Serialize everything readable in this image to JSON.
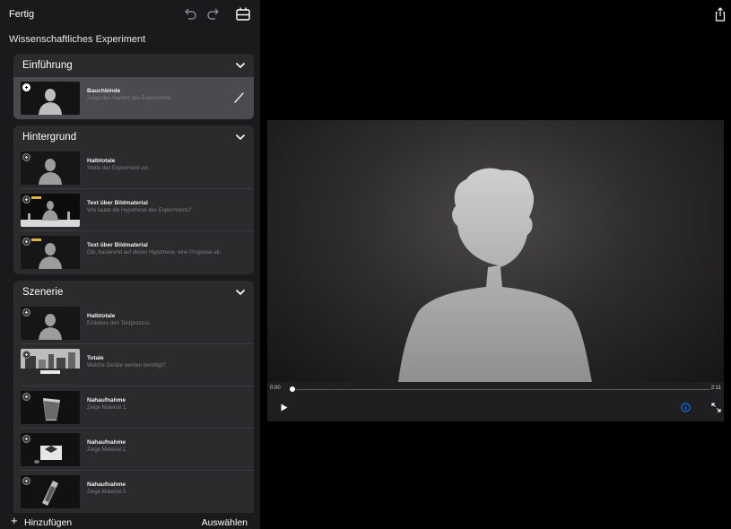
{
  "toolbar": {
    "done_label": "Fertig",
    "icons": [
      "undo-icon",
      "redo-icon",
      "storyboard-icon"
    ]
  },
  "project": {
    "title": "Wissenschaftliches Experiment"
  },
  "sections": [
    {
      "title": "Einführung",
      "shots": [
        {
          "title": "Bauchbinde",
          "description": "Zeige den Namen des Experiments.",
          "selected": true,
          "thumbnail": "person-silhouette"
        }
      ]
    },
    {
      "title": "Hintergrund",
      "shots": [
        {
          "title": "Halbtotale",
          "description": "Stelle das Experiment vor.",
          "thumbnail": "person-silhouette"
        },
        {
          "title": "Text über Bildmaterial",
          "description": "Wie lautet die Hypothese des Experiments?",
          "thumbnail": "lab-wide-with-title"
        },
        {
          "title": "Text über Bildmaterial",
          "description": "Gib, basierend auf deiner Hypothese, eine Prognose ab.",
          "thumbnail": "person-with-title"
        }
      ]
    },
    {
      "title": "Szenerie",
      "shots": [
        {
          "title": "Halbtotale",
          "description": "Erläutere den Testprozess.",
          "thumbnail": "person-silhouette"
        },
        {
          "title": "Totale",
          "description": "Welche Geräte werden benötigt?",
          "thumbnail": "lab-equipment"
        },
        {
          "title": "Nahaufnahme",
          "description": "Zeige Material 1.",
          "thumbnail": "beaker-closeup"
        },
        {
          "title": "Nahaufnahme",
          "description": "Zeige Material 2.",
          "thumbnail": "dish-closeup"
        },
        {
          "title": "Nahaufnahme",
          "description": "Zeige Material 3.",
          "thumbnail": "tube-closeup"
        }
      ]
    }
  ],
  "bottom_bar": {
    "add_label": "Hinzufügen",
    "add_icon": "+",
    "select_label": "Auswählen"
  },
  "player": {
    "time_current": "0:00",
    "time_total": "2:11",
    "progress": 0.0,
    "icons": [
      "share-icon",
      "play-icon",
      "info-icon",
      "fullscreen-icon"
    ]
  },
  "colors": {
    "sidebar_bg": "#1a1a1c",
    "section_bg": "#2b2b2e",
    "selected_row": "#4b4b4f",
    "accent_blue": "#0a84ff"
  }
}
